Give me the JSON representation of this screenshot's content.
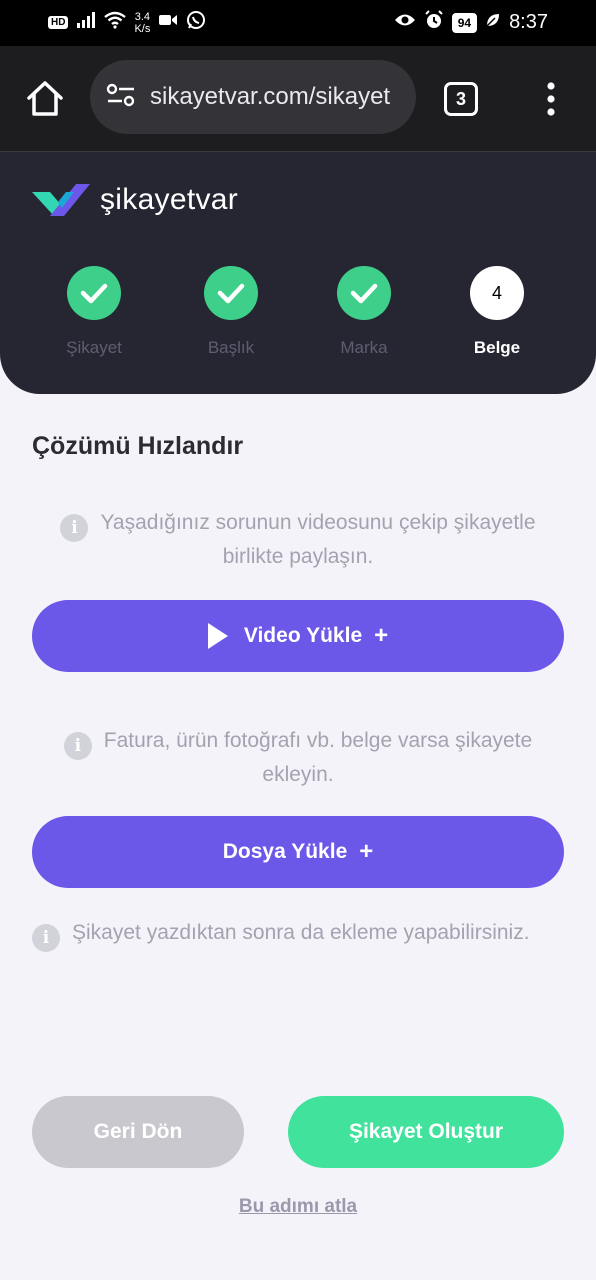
{
  "status_bar": {
    "hd_badge": "HD",
    "network_speed_value": "3.4",
    "network_speed_unit": "K/s",
    "battery": "94",
    "time": "8:37",
    "left_icons": [
      "signal-icon",
      "wifi-icon",
      "video-icon",
      "whatsapp-icon"
    ],
    "right_icons": [
      "eye-icon",
      "alarm-icon",
      "battery-icon",
      "leaf-icon"
    ]
  },
  "browser": {
    "url": "sikayetvar.com/sikayet",
    "tab_count": "3"
  },
  "header": {
    "logo_text": "şikayetvar",
    "steps": [
      {
        "label": "Şikayet",
        "state": "done"
      },
      {
        "label": "Başlık",
        "state": "done"
      },
      {
        "label": "Marka",
        "state": "done"
      },
      {
        "label": "Belge",
        "state": "current",
        "number": "4"
      }
    ]
  },
  "main": {
    "title": "Çözümü Hızlandır",
    "video_info": "Yaşadığınız sorunun videosunu çekip şikayetle birlikte paylaşın.",
    "video_button": "Video Yükle",
    "file_info": "Fatura, ürün fotoğrafı vb. belge varsa şikayete ekleyin.",
    "file_button": "Dosya Yükle",
    "later_info": "Şikayet yazdıktan sonra da ekleme yapabilirsiniz.",
    "plus_symbol": "+",
    "info_symbol": "i"
  },
  "footer": {
    "back_button": "Geri Dön",
    "create_button": "Şikayet Oluştur",
    "skip_link": "Bu adımı atla"
  },
  "colors": {
    "accent_purple": "#6b57e8",
    "accent_green": "#41e29c",
    "header_bg": "#262633",
    "step_done": "#3ed08b"
  }
}
